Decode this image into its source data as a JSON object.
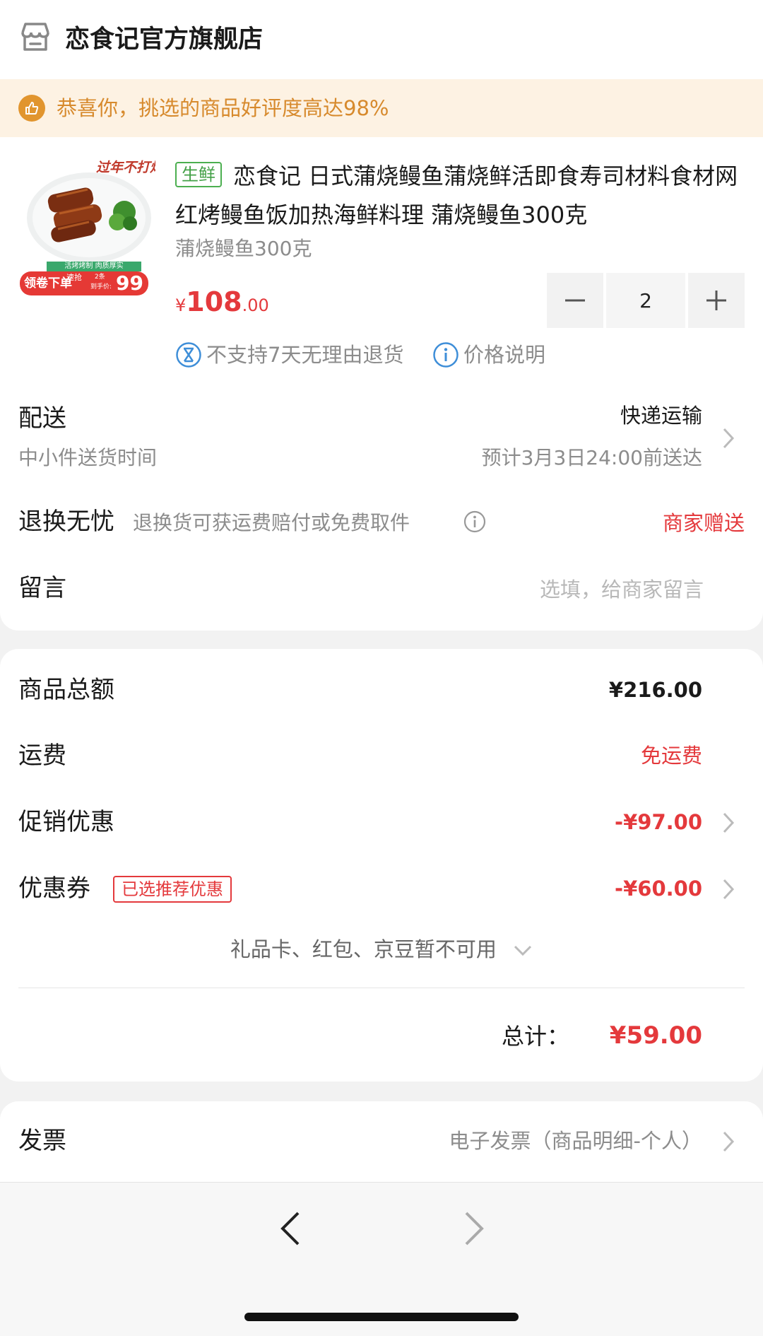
{
  "store": {
    "name": "恋食记官方旗舰店",
    "icon": "store-icon"
  },
  "notice": {
    "icon": "thumbs-up-icon",
    "text": "恭喜你，挑选的商品好评度高达98%"
  },
  "product": {
    "image_banner_text": "过年不打烊",
    "image_promo": {
      "left": "领卷下单",
      "mid": "速抢",
      "small1": "2条",
      "small2": "到手价:",
      "price": "99",
      "top": "活烤烤制  肉质厚实"
    },
    "tag": "生鲜",
    "title": "恋食记 日式蒲烧鳗鱼蒲烧鲜活即食寿司材料食材网红烤鳗鱼饭加热海鲜料理 蒲烧鳗鱼300克",
    "spec": "蒲烧鳗鱼300克",
    "price": {
      "currency": "¥",
      "integer": "108",
      "decimal": ".00"
    },
    "quantity": "2",
    "no_return_text": "不支持7天无理由退货",
    "price_note_text": "价格说明"
  },
  "delivery": {
    "label": "配送",
    "sub_label": "中小件送货时间",
    "method": "快递运输",
    "eta": "预计3月3日24:00前送达"
  },
  "returns": {
    "label": "退换无忧",
    "desc": "退换货可获运费赔付或免费取件",
    "gift": "商家赠送"
  },
  "message": {
    "label": "留言",
    "placeholder": "选填，给商家留言"
  },
  "summary": {
    "goods_total_label": "商品总额",
    "goods_total_value": "¥216.00",
    "shipping_label": "运费",
    "shipping_value": "免运费",
    "promo_label": "促销优惠",
    "promo_value": "-¥97.00",
    "coupon_label": "优惠券",
    "coupon_tag": "已选推荐优惠",
    "coupon_value": "-¥60.00",
    "unavailable_text": "礼品卡、红包、京豆暂不可用",
    "total_label": "总计：",
    "total_value": "¥59.00"
  },
  "invoice": {
    "label": "发票",
    "value": "电子发票（商品明细-个人）"
  },
  "colors": {
    "accent_red": "#e4393c",
    "notice_orange": "#d78a2d",
    "fresh_green": "#43a047",
    "link_blue": "#3e8ed8"
  }
}
